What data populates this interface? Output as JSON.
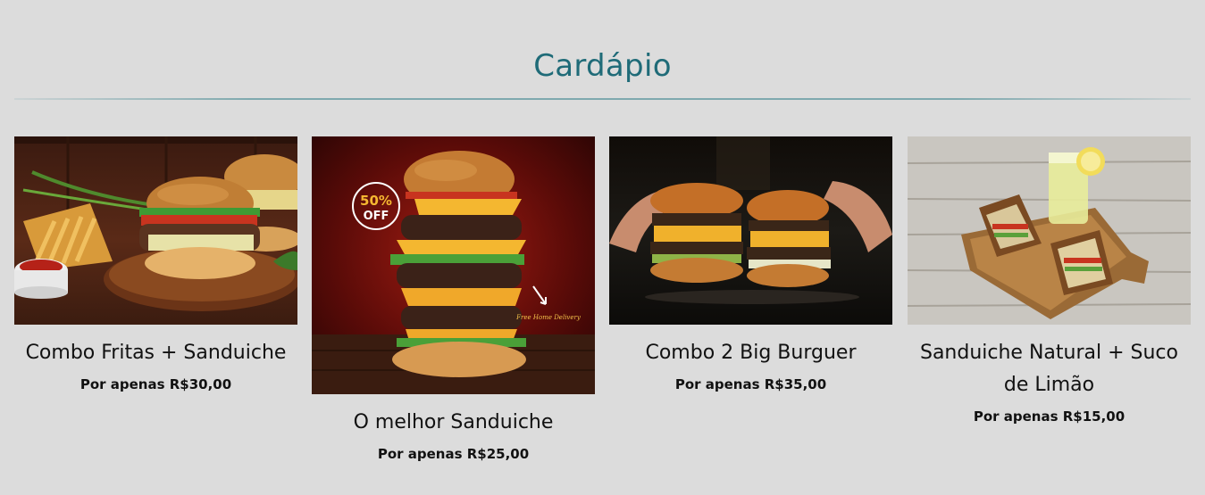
{
  "menu": {
    "title": "Cardápio",
    "accent_color": "#1f6b78",
    "items": [
      {
        "name": "Combo Fritas + Sanduiche",
        "price": "Por apenas R$30,00",
        "image": "burger-with-fries-photo"
      },
      {
        "name": "O melhor Sanduiche",
        "price": "Por apenas R$25,00",
        "image": "stacked-burger-promo-photo",
        "badge": {
          "percent": "50%",
          "off": "OFF"
        },
        "note": "Free Home Delivery"
      },
      {
        "name": "Combo 2 Big Burguer",
        "price": "Por apenas R$35,00",
        "image": "two-burgers-photo"
      },
      {
        "name": "Sanduiche Natural + Suco de Limão",
        "price": "Por apenas R$15,00",
        "image": "club-sandwich-lemonade-photo"
      }
    ]
  }
}
